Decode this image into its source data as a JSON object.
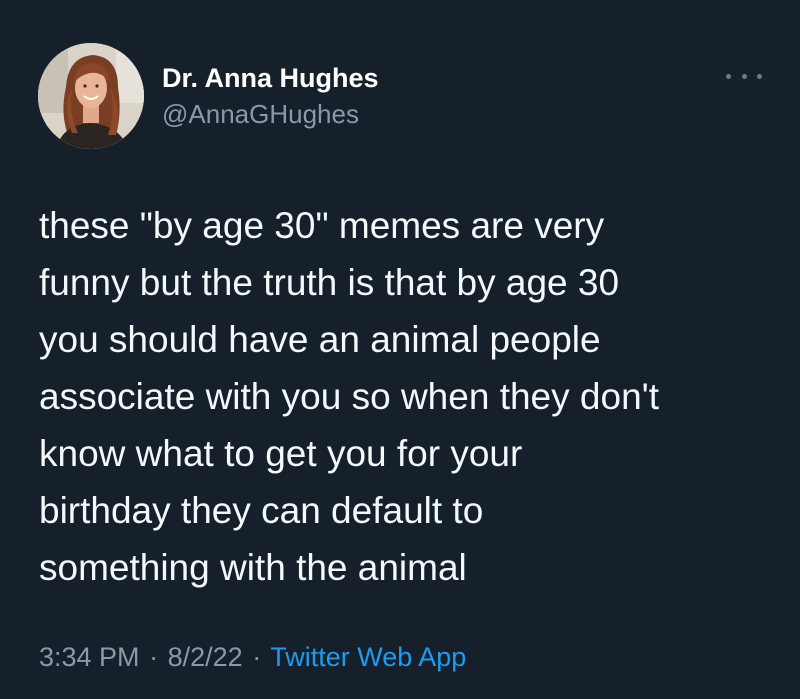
{
  "tweet": {
    "author": {
      "display_name": "Dr. Anna Hughes",
      "handle": "@AnnaGHughes",
      "avatar_icon": "profile-photo"
    },
    "more_icon": "ellipsis-icon",
    "text": "these \"by age 30\" memes are very\nfunny but the truth is that by age 30\nyou should have an animal people\nassociate with you so when they don't\nknow what to get you for your\nbirthday they can default to\nsomething with the animal",
    "meta": {
      "time": "3:34 PM",
      "separator": "·",
      "date": "8/2/22",
      "source": "Twitter Web App"
    }
  },
  "colors": {
    "background": "#15202b",
    "text": "#f5f8fa",
    "secondary_text": "#8b98a5",
    "link": "#1d9bf0"
  }
}
